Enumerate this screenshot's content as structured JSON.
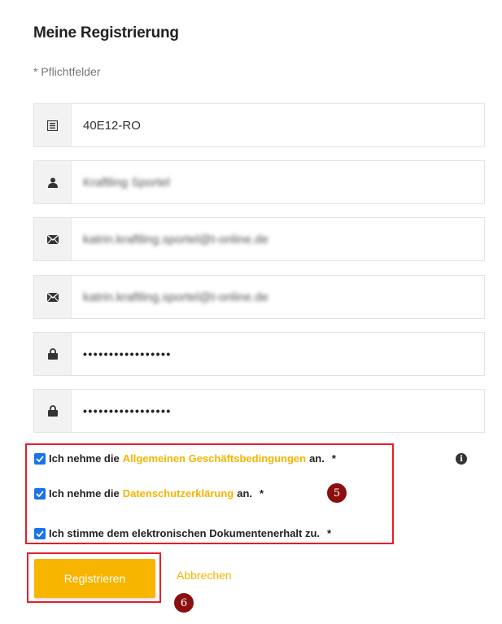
{
  "page": {
    "title": "Meine Registrierung",
    "required_note": "* Pflichtfelder"
  },
  "form": {
    "fields": [
      {
        "icon": "id-card-icon",
        "value": "40E12-RO"
      },
      {
        "icon": "user-icon",
        "value": "Kraftling Sportel"
      },
      {
        "icon": "mail-icon",
        "value": "katrin.kraftling.sportel@t-online.de"
      },
      {
        "icon": "mail-icon",
        "value": "katrin.kraftling.sportel@t-online.de"
      },
      {
        "icon": "lock-icon",
        "value": "•••••••••••••••••"
      },
      {
        "icon": "lock-icon",
        "value": "•••••••••••••••••"
      }
    ]
  },
  "consents": [
    {
      "checked": true,
      "prefix": "Ich nehme die",
      "link": "Allgemeinen Geschäftsbedingungen",
      "suffix": "an.",
      "required": "*"
    },
    {
      "checked": true,
      "prefix": "Ich nehme die",
      "link": "Datenschutzerklärung",
      "suffix": "an.",
      "required": "*"
    },
    {
      "checked": true,
      "text": "Ich stimme dem elektronischen Dokumentenerhalt zu.",
      "required": "*"
    }
  ],
  "info_icon": "i",
  "annotations": {
    "consents_step": "5",
    "register_step": "6"
  },
  "actions": {
    "register_label": "Registrieren",
    "cancel_label": "Abbrechen"
  },
  "colors": {
    "accent": "#f7b500",
    "link": "#f5b400",
    "highlight_frame": "#e31e2b",
    "step_badge": "#8b0f0f",
    "checkbox": "#1a73e8"
  }
}
